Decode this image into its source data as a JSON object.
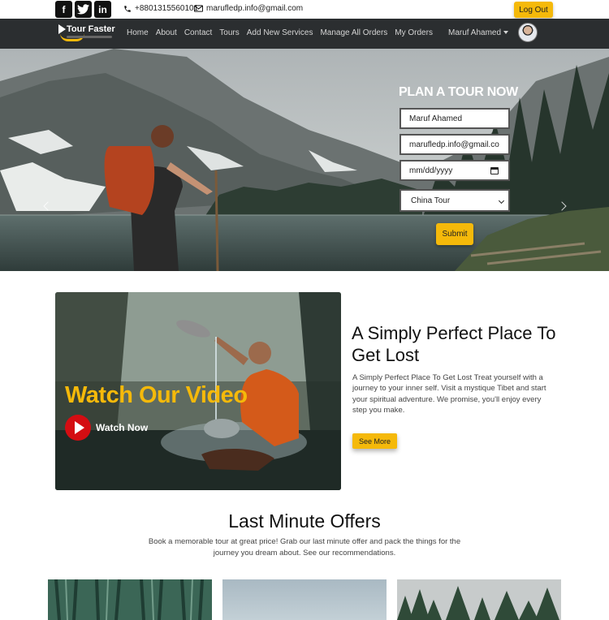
{
  "topbar": {
    "social": [
      "facebook-icon",
      "twitter-icon",
      "linkedin-icon"
    ],
    "phone": "+8801315560101",
    "email": "marufledp.info@gmail.com",
    "logout_label": "Log Out"
  },
  "navbar": {
    "brand": "Tour Faster",
    "links": [
      "Home",
      "About",
      "Contact",
      "Tours",
      "Add New Services",
      "Manage All Orders",
      "My Orders"
    ],
    "user_name": "Maruf Ahamed"
  },
  "hero": {
    "form_title": "PLAN A TOUR NOW",
    "name_value": "Maruf Ahamed",
    "email_value": "marufledp.info@gmail.co",
    "date_placeholder": "mm/dd/yyyy",
    "tour_selected": "China Tour",
    "submit_label": "Submit"
  },
  "video": {
    "title": "Watch Our Video",
    "watch_label": "Watch Now"
  },
  "about": {
    "title": "A Simply Perfect Place To Get Lost",
    "text": "A Simply Perfect Place To Get Lost Treat yourself with a journey to your inner self. Visit a mystique Tibet and start your spiritual adventure. We promise, you'll enjoy every step you make.",
    "button_label": "See More"
  },
  "offers": {
    "title": "Last Minute Offers",
    "text": "Book a memorable tour at great price! Grab our last minute offer and pack the things for the journey you dream about. See our recommendations."
  },
  "colors": {
    "accent": "#f5b90a",
    "navbar": "#2b2e30",
    "play": "#d40d12"
  }
}
